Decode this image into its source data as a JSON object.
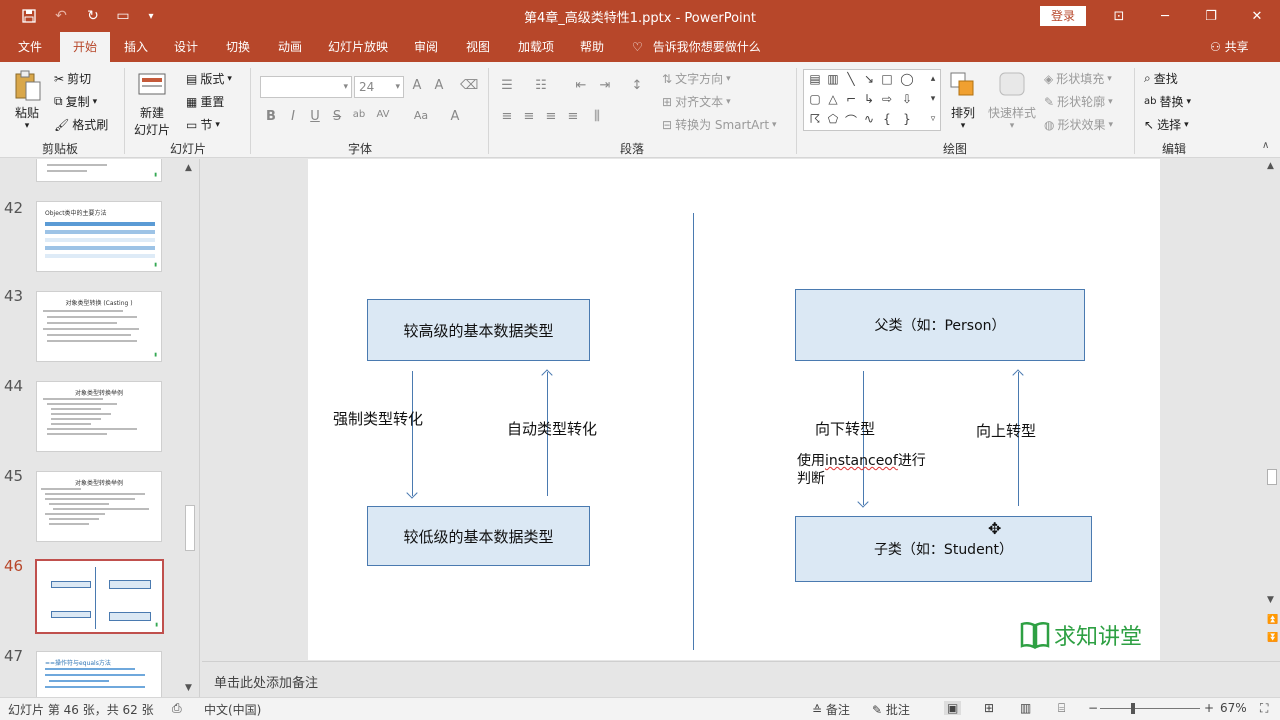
{
  "window": {
    "title": "第4章_高级类特性1.pptx  -  PowerPoint",
    "login_label": "登录",
    "buttons": [
      "ribbon-display-icon",
      "minimize-icon",
      "restore-icon",
      "close-icon"
    ]
  },
  "tabs": [
    "文件",
    "开始",
    "插入",
    "设计",
    "切换",
    "动画",
    "幻灯片放映",
    "审阅",
    "视图",
    "加载项",
    "帮助"
  ],
  "active_tab": "开始",
  "tell_me": "告诉我你想要做什么",
  "share": "共享",
  "ribbon": {
    "clipboard": {
      "paste": "粘贴",
      "cut": "剪切",
      "copy": "复制",
      "format_painter": "格式刷",
      "group": "剪贴板"
    },
    "slides": {
      "new_slide_1": "新建",
      "new_slide_2": "幻灯片",
      "layout": "版式",
      "reset": "重置",
      "section": "节",
      "group": "幻灯片"
    },
    "font": {
      "font_size": "24",
      "group": "字体",
      "buttons": [
        "B",
        "I",
        "U",
        "S",
        "ab",
        "AV",
        "Aa",
        "A"
      ]
    },
    "paragraph": {
      "text_direction": "文字方向",
      "align_text": "对齐文本",
      "smartart": "转换为 SmartArt",
      "group": "段落"
    },
    "drawing": {
      "arrange": "排列",
      "quick_styles": "快速样式",
      "shape_fill": "形状填充",
      "shape_outline": "形状轮廓",
      "shape_effects": "形状效果",
      "group": "绘图"
    },
    "editing": {
      "find": "查找",
      "replace": "替换",
      "select": "选择",
      "group": "编辑"
    }
  },
  "thumbnails": [
    {
      "num": "",
      "title": ""
    },
    {
      "num": "42",
      "title": "Object类中的主要方法"
    },
    {
      "num": "43",
      "title": "对象类型转换 (Casting )"
    },
    {
      "num": "44",
      "title": "对象类型转换举例"
    },
    {
      "num": "45",
      "title": "对象类型转换举例"
    },
    {
      "num": "46",
      "title": ""
    },
    {
      "num": "47",
      "title": "==操作符与equals方法"
    }
  ],
  "active_thumbnail": "46",
  "slide": {
    "left_top_box": "较高级的基本数据类型",
    "left_bottom_box": "较低级的基本数据类型",
    "left_down_label": "强制类型转化",
    "left_up_label": "自动类型转化",
    "right_top_box": "父类（如：Person）",
    "right_bottom_box": "子类（如：Student）",
    "right_down_label": "向下转型",
    "right_up_label": "向上转型",
    "instanceof_prefix": "使用",
    "instanceof_word": "instanceof",
    "instanceof_suffix": "进行",
    "instanceof_line2": "判断",
    "logo_text": "求知讲堂"
  },
  "notes_placeholder": "单击此处添加备注",
  "status": {
    "slide_count": "幻灯片 第 46 张，共 62 张",
    "language": "中文(中国)",
    "notes": "备注",
    "comments": "批注",
    "zoom": "67%"
  },
  "colors": {
    "accent": "#b7472a",
    "box_fill": "#dbe8f4",
    "box_border": "#4a7ab0",
    "logo": "#2ea043"
  }
}
